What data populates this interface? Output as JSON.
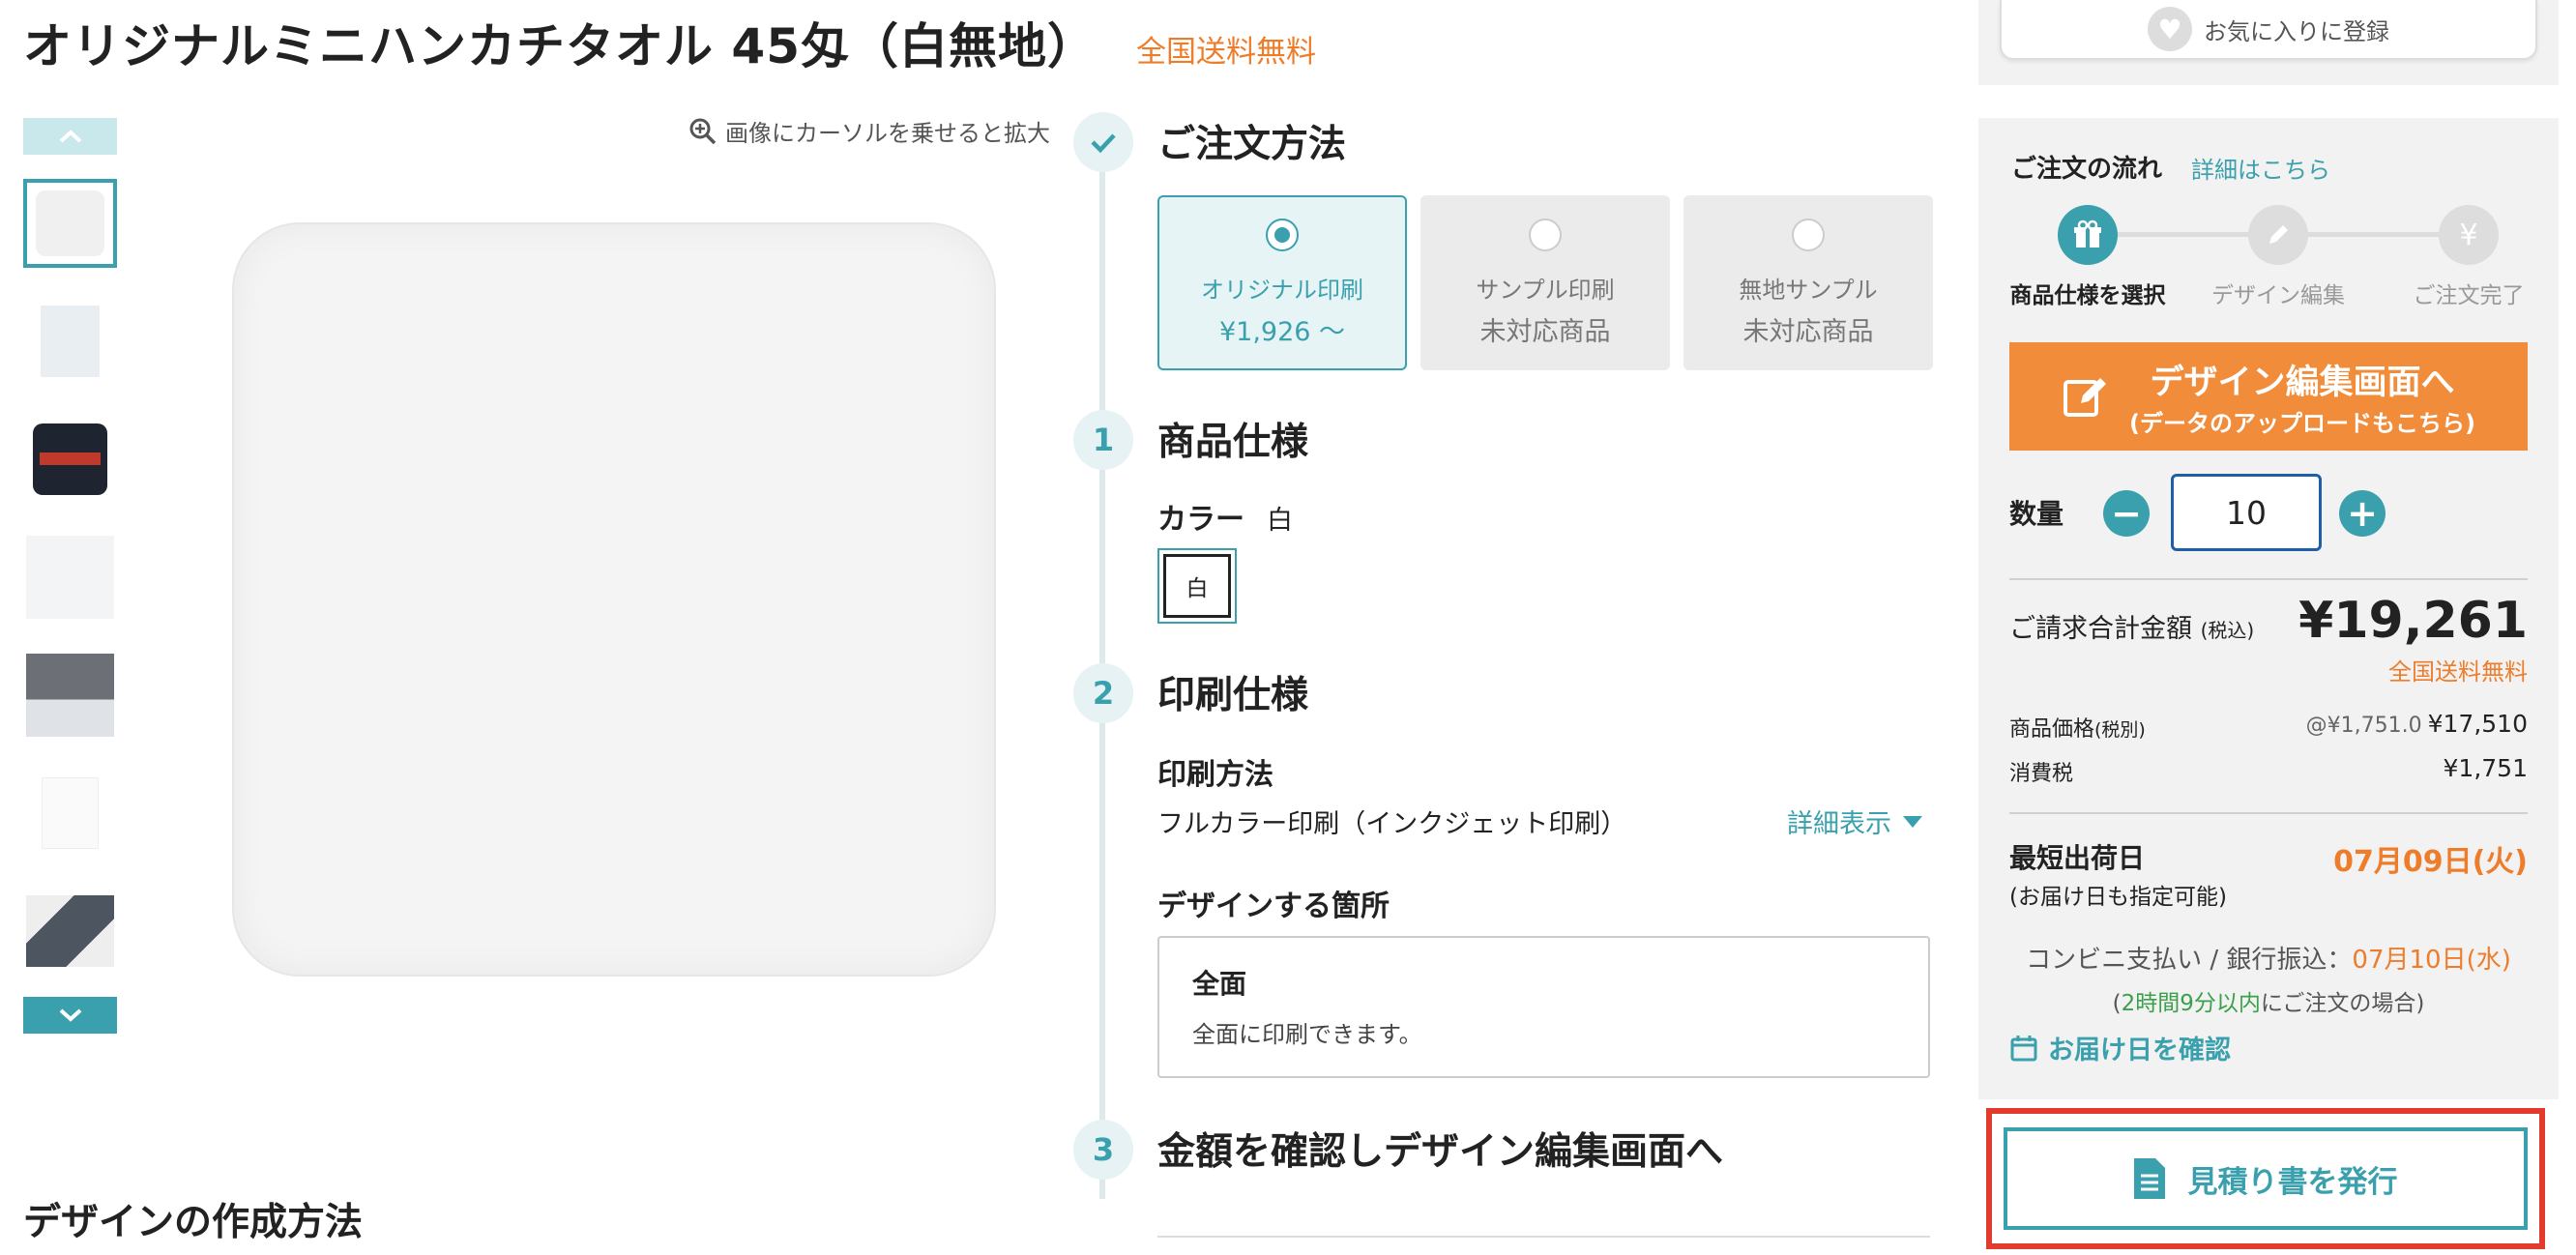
{
  "product": {
    "title": "オリジナルミニハンカチタオル 45匁（白無地）",
    "free_shipping": "全国送料無料"
  },
  "gallery": {
    "zoom_hint": "画像にカーソルを乗せると拡大"
  },
  "order_method": {
    "heading": "ご注文方法",
    "options": [
      {
        "label": "オリジナル印刷",
        "price": "¥1,926 〜",
        "selected": true
      },
      {
        "label": "サンプル印刷",
        "price": "未対応商品",
        "selected": false
      },
      {
        "label": "無地サンプル",
        "price": "未対応商品",
        "selected": false
      }
    ]
  },
  "spec": {
    "step": "1",
    "heading": "商品仕様",
    "color_label": "カラー",
    "color_value": "白",
    "swatch_label": "白"
  },
  "print": {
    "step": "2",
    "heading": "印刷仕様",
    "method_label": "印刷方法",
    "method_value": "フルカラー印刷（インクジェット印刷）",
    "detail_link": "詳細表示",
    "area_label": "デザインする箇所",
    "area_title": "全面",
    "area_desc": "全面に印刷できます。"
  },
  "confirm": {
    "step": "3",
    "heading": "金額を確認しデザイン編集画面へ"
  },
  "design_howto": "デザインの作成方法",
  "sidebar": {
    "favorite_label": "お気に入りに登録",
    "flow_title": "ご注文の流れ",
    "flow_link": "詳細はこちら",
    "flow_steps": [
      "商品仕様を選択",
      "デザイン編集",
      "ご注文完了"
    ],
    "cta_main": "デザイン編集画面へ",
    "cta_sub": "(データのアップロードもこちら)",
    "qty_label": "数量",
    "qty_value": "10",
    "total_label": "ご請求合計金額",
    "total_tax_note": "(税込)",
    "total_amount": "¥19,261",
    "total_free_ship": "全国送料無料",
    "price_label": "商品価格",
    "price_tax_note": "(税別)",
    "price_unit": "@¥1,751.0",
    "price_value": "¥17,510",
    "tax_label": "消費税",
    "tax_value": "¥1,751",
    "ship_label": "最短出荷日",
    "ship_date": "07月09日(火)",
    "ship_note": "(お届け日も指定可能)",
    "pay_prefix": "コンビニ支払い / 銀行振込：",
    "pay_date": "07月10日(水)",
    "pay_cond_open": "(",
    "pay_cond_time": "2時間9分以内",
    "pay_cond_rest": "にご注文の場合)",
    "delivery_link": "お届け日を確認",
    "quote_button": "見積り書を発行"
  },
  "colors": {
    "accent": "#3aa0ad",
    "orange": "#ee7d2b",
    "cta": "#f08c3a",
    "highlight": "#e23b2e"
  }
}
